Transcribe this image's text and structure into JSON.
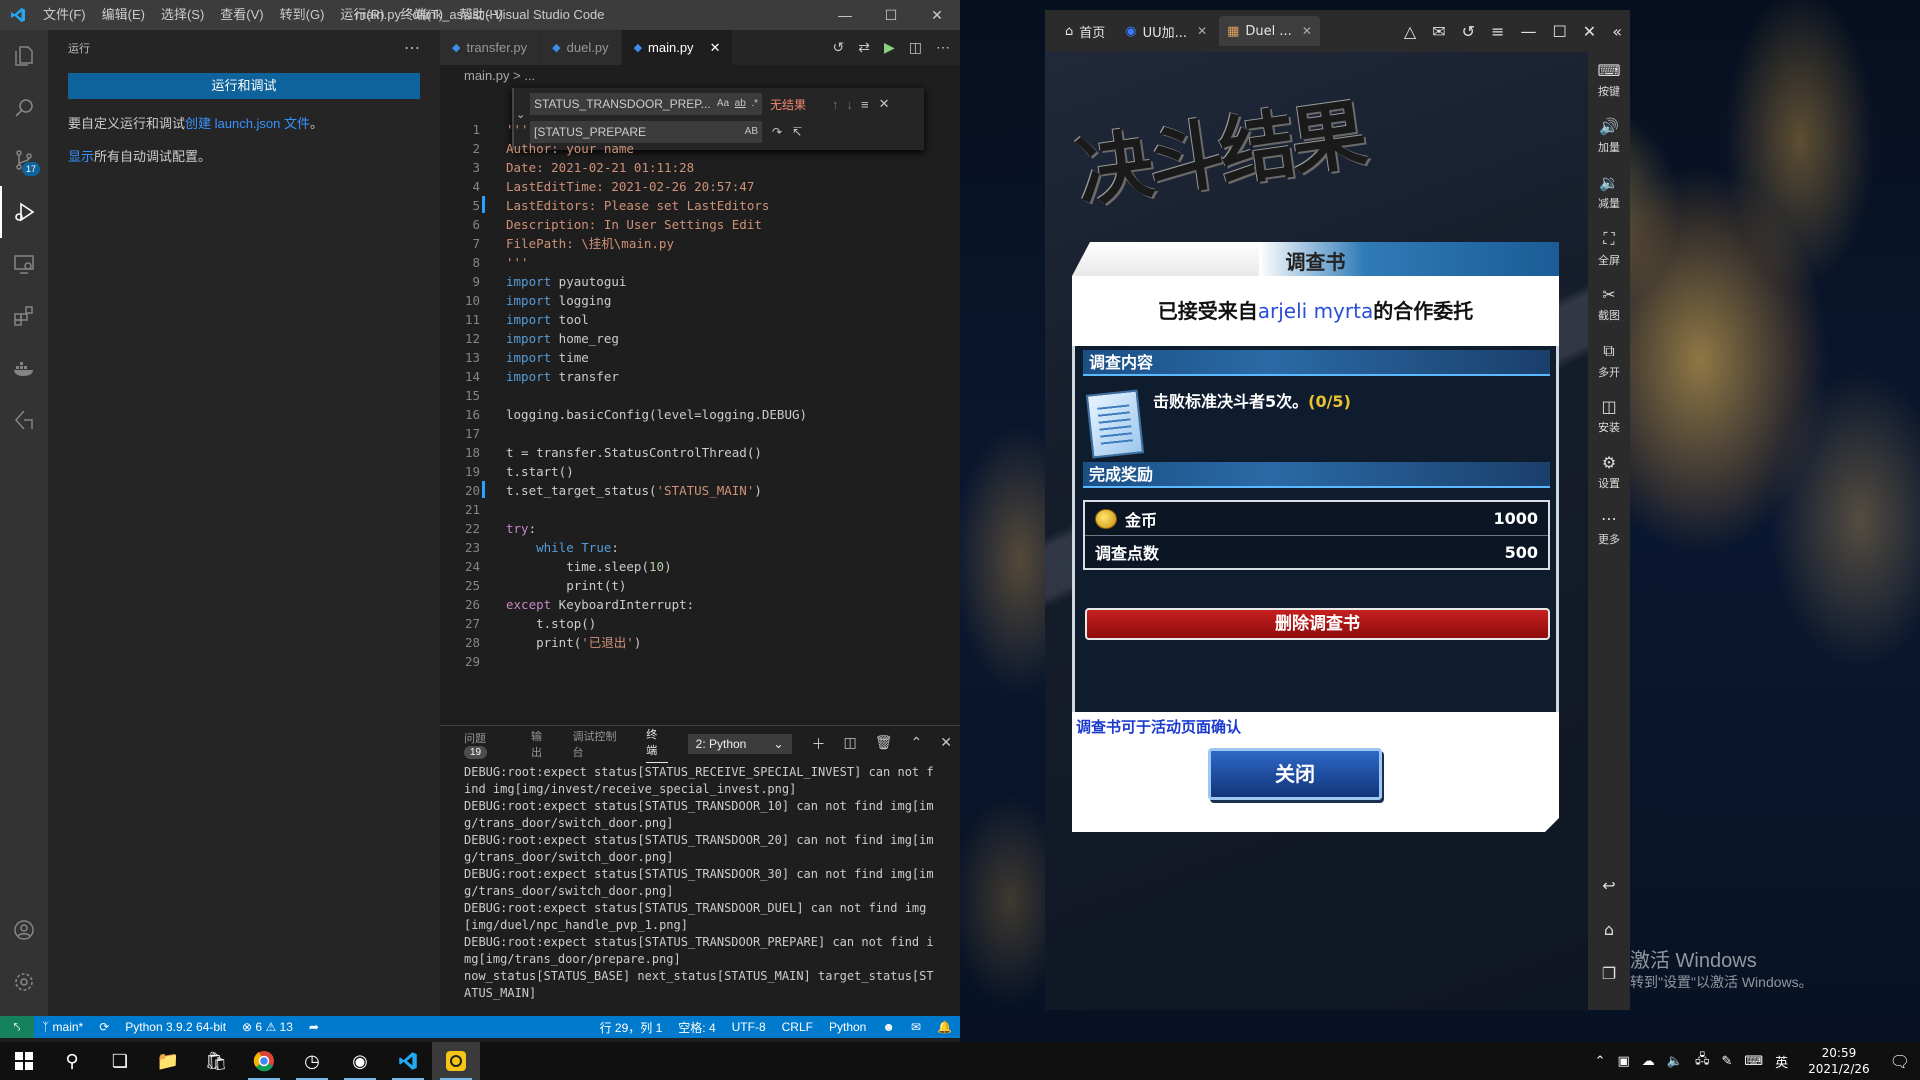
{
  "vscode": {
    "window_title": "main.py - dllink_assist - Visual Studio Code",
    "menu": [
      "文件(F)",
      "编辑(E)",
      "选择(S)",
      "查看(V)",
      "转到(G)",
      "运行(R)",
      "终端(T)",
      "帮助(H)"
    ],
    "activity_badge": "17",
    "sidebar": {
      "title": "运行",
      "run_button": "运行和调试",
      "line1_prefix": "要自定义运行和调试",
      "line1_link": "创建 launch.json 文件",
      "line1_suffix": "。",
      "line2_link": "显示",
      "line2_suffix": "所有自动调试配置。"
    },
    "tabs": [
      "transfer.py",
      "duel.py",
      "main.py"
    ],
    "breadcrumb": "main.py > ...",
    "find": {
      "search_value": "STATUS_TRANSDOOR_PREP...",
      "replace_value": "[STATUS_PREPARE",
      "no_results": "无结果"
    },
    "code_lines": [
      "'''",
      "Author: your name",
      "Date: 2021-02-21 01:11:28",
      "LastEditTime: 2021-02-26 20:57:47",
      "LastEditors: Please set LastEditors",
      "Description: In User Settings Edit",
      "FilePath: \\挂机\\main.py",
      "'''",
      "import pyautogui",
      "import logging",
      "import tool",
      "import home_reg",
      "import time",
      "import transfer",
      "",
      "logging.basicConfig(level=logging.DEBUG)",
      "",
      "t = transfer.StatusControlThread()",
      "t.start()",
      "t.set_target_status('STATUS_MAIN')",
      "",
      "try:",
      "    while True:",
      "        time.sleep(10)",
      "        print(t)",
      "except KeyboardInterrupt:",
      "    t.stop()",
      "    print('已退出')",
      ""
    ],
    "panel": {
      "tabs": [
        "问题",
        "输出",
        "调试控制台",
        "终端"
      ],
      "problems_count": "19",
      "terminal_select": "2: Python",
      "terminal_text": "DEBUG:root:expect status[STATUS_RECEIVE_SPECIAL_INVEST] can not find img[img/invest/receive_special_invest.png]\nDEBUG:root:expect status[STATUS_TRANSDOOR_10] can not find img[img/trans_door/switch_door.png]\nDEBUG:root:expect status[STATUS_TRANSDOOR_20] can not find img[img/trans_door/switch_door.png]\nDEBUG:root:expect status[STATUS_TRANSDOOR_30] can not find img[img/trans_door/switch_door.png]\nDEBUG:root:expect status[STATUS_TRANSDOOR_DUEL] can not find img[img/duel/npc_handle_pvp_1.png]\nDEBUG:root:expect status[STATUS_TRANSDOOR_PREPARE] can not find img[img/trans_door/prepare.png]\nnow_status[STATUS_BASE] next_status[STATUS_MAIN] target_status[STATUS_MAIN]"
    },
    "status": {
      "branch": "main*",
      "python": "Python 3.9.2 64-bit",
      "errors": "6",
      "warnings": "13",
      "position": "行 29，列 1",
      "spaces": "空格: 4",
      "encoding": "UTF-8",
      "eol": "CRLF",
      "language": "Python"
    }
  },
  "emulator": {
    "tabs": [
      "首页",
      "UU加...",
      "Duel ..."
    ],
    "side_buttons": [
      "按键",
      "加量",
      "减量",
      "全屏",
      "截图",
      "多开",
      "安装",
      "设置",
      "更多"
    ],
    "game": {
      "banner": "决斗结果",
      "dialog_title": "调查书",
      "subtitle_prefix": "已接受来自",
      "subtitle_name": "arjeli myrta",
      "subtitle_suffix": "的合作委托",
      "section_content": "调查内容",
      "mission_text": "击败标准决斗者5次。",
      "mission_progress": "(0/5)",
      "section_reward": "完成奖励",
      "rewards": [
        {
          "label": "金币",
          "value": "1000"
        },
        {
          "label": "调查点数",
          "value": "500"
        }
      ],
      "delete_button": "删除调查书",
      "hint": "调查书可于活动页面确认",
      "close_button": "关闭"
    }
  },
  "desktop": {
    "activate_title": "激活 Windows",
    "activate_sub": "转到\"设置\"以激活 Windows。"
  },
  "taskbar": {
    "ime": "英",
    "time": "20:59",
    "date": "2021/2/26"
  }
}
